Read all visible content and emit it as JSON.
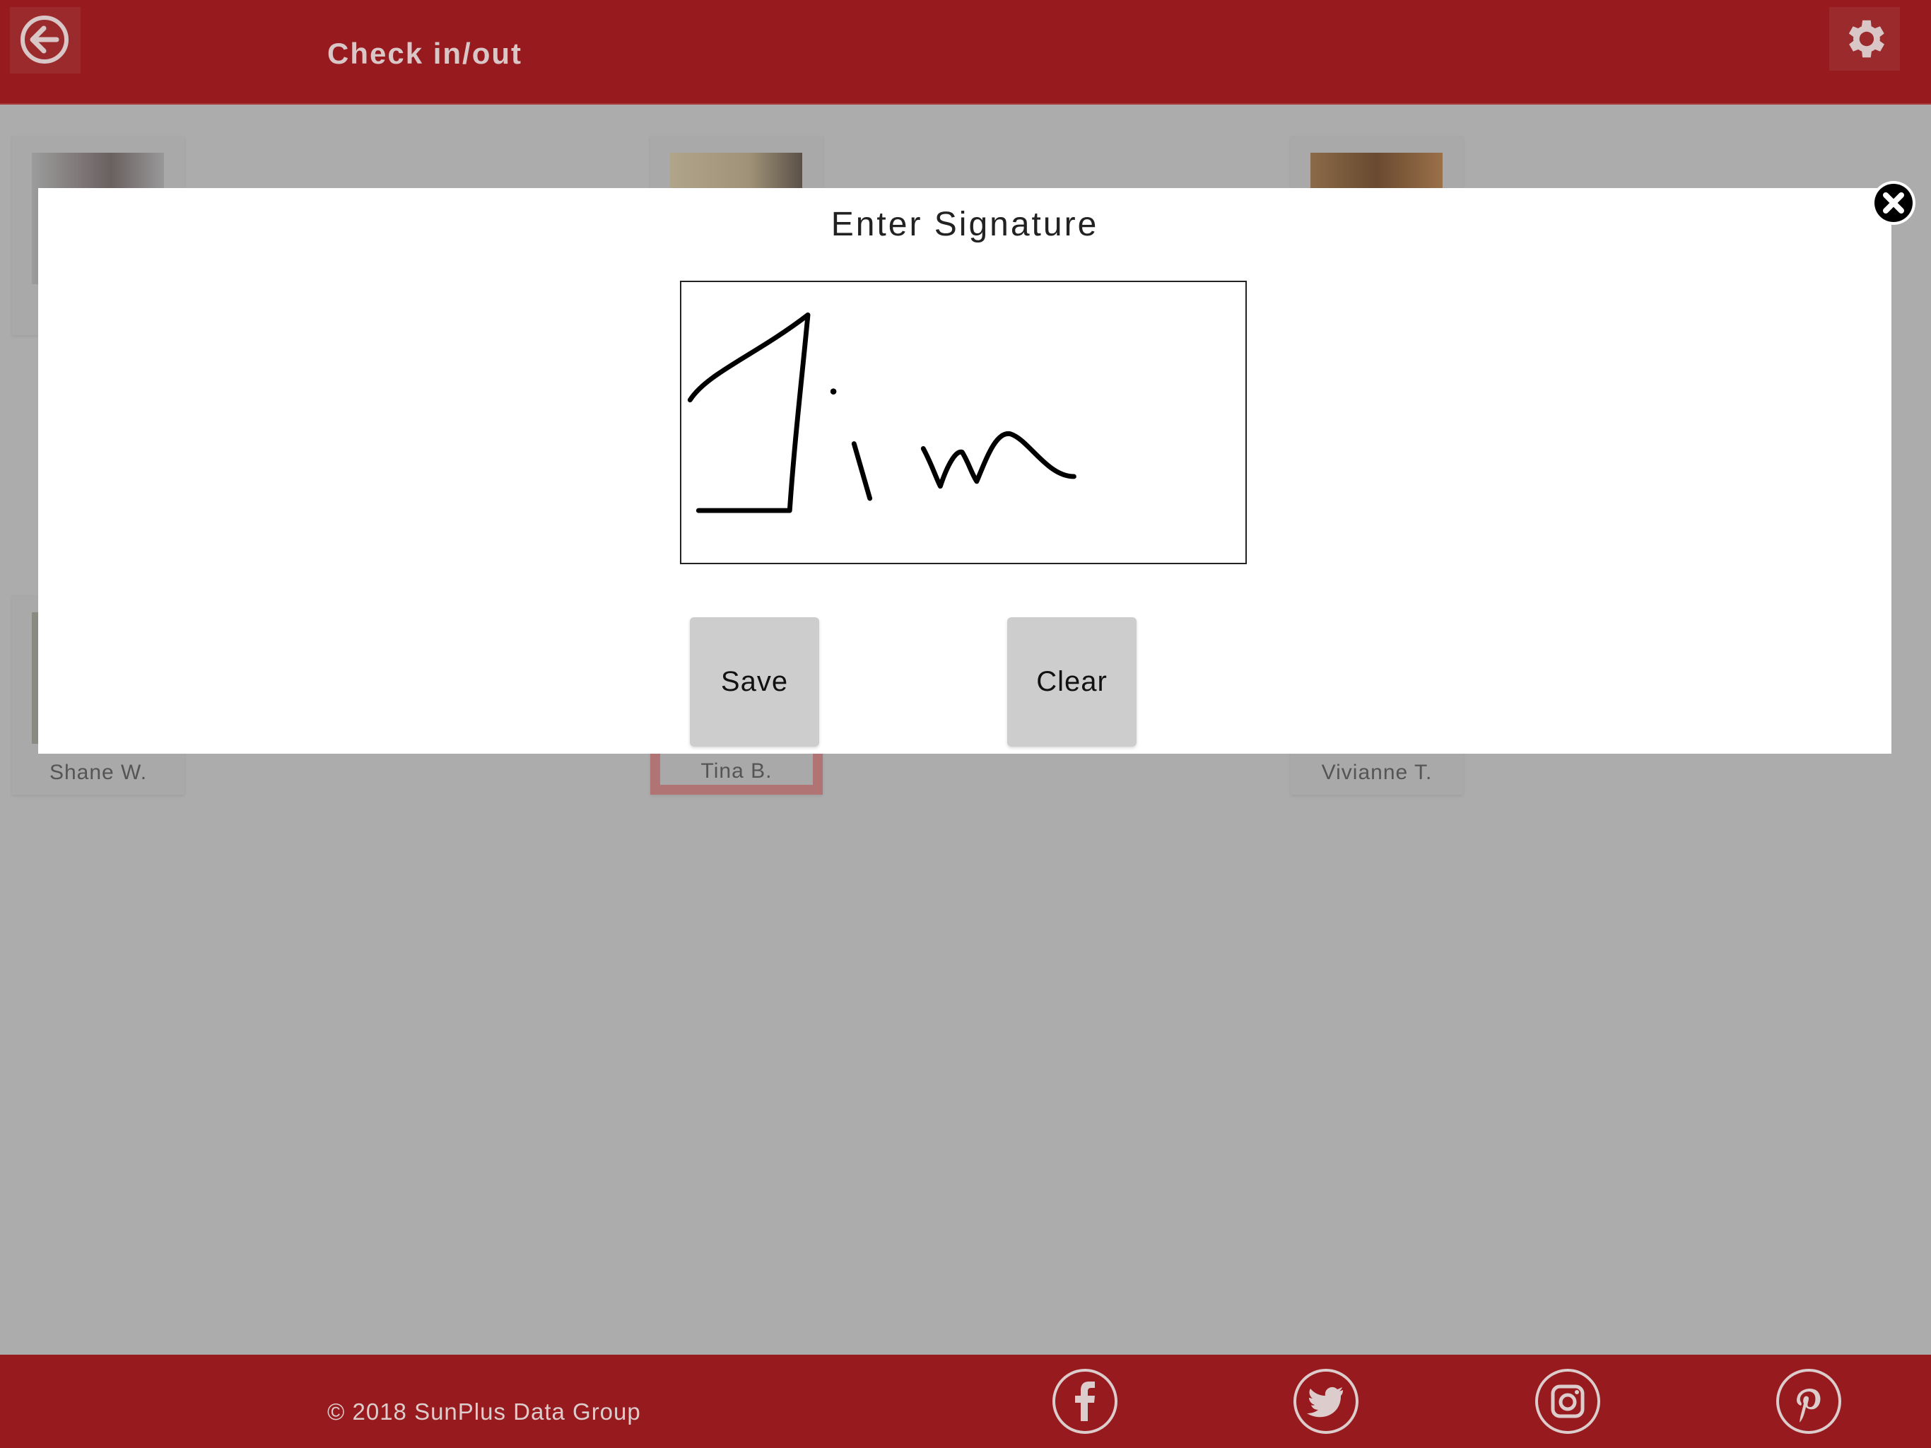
{
  "header": {
    "title": "Check in/out",
    "back_icon": "arrow-left-circle-icon",
    "settings_icon": "gear-icon"
  },
  "cards": [
    {
      "name": ""
    },
    {
      "name": ""
    },
    {
      "name": ""
    },
    {
      "name": "Shane W."
    },
    {
      "name": "Tina B.",
      "selected": true
    },
    {
      "name": "Vivianne T."
    }
  ],
  "modal": {
    "title": "Enter Signature",
    "save_label": "Save",
    "clear_label": "Clear",
    "close_icon": "close-circle-icon",
    "signature_text": "Jim"
  },
  "footer": {
    "copyright": "© 2018 SunPlus Data Group",
    "social": [
      "facebook-icon",
      "twitter-icon",
      "instagram-icon",
      "pinterest-icon"
    ]
  },
  "colors": {
    "brand": "#961a1e",
    "overlay": "#acacac",
    "button": "#cdcdcd"
  }
}
